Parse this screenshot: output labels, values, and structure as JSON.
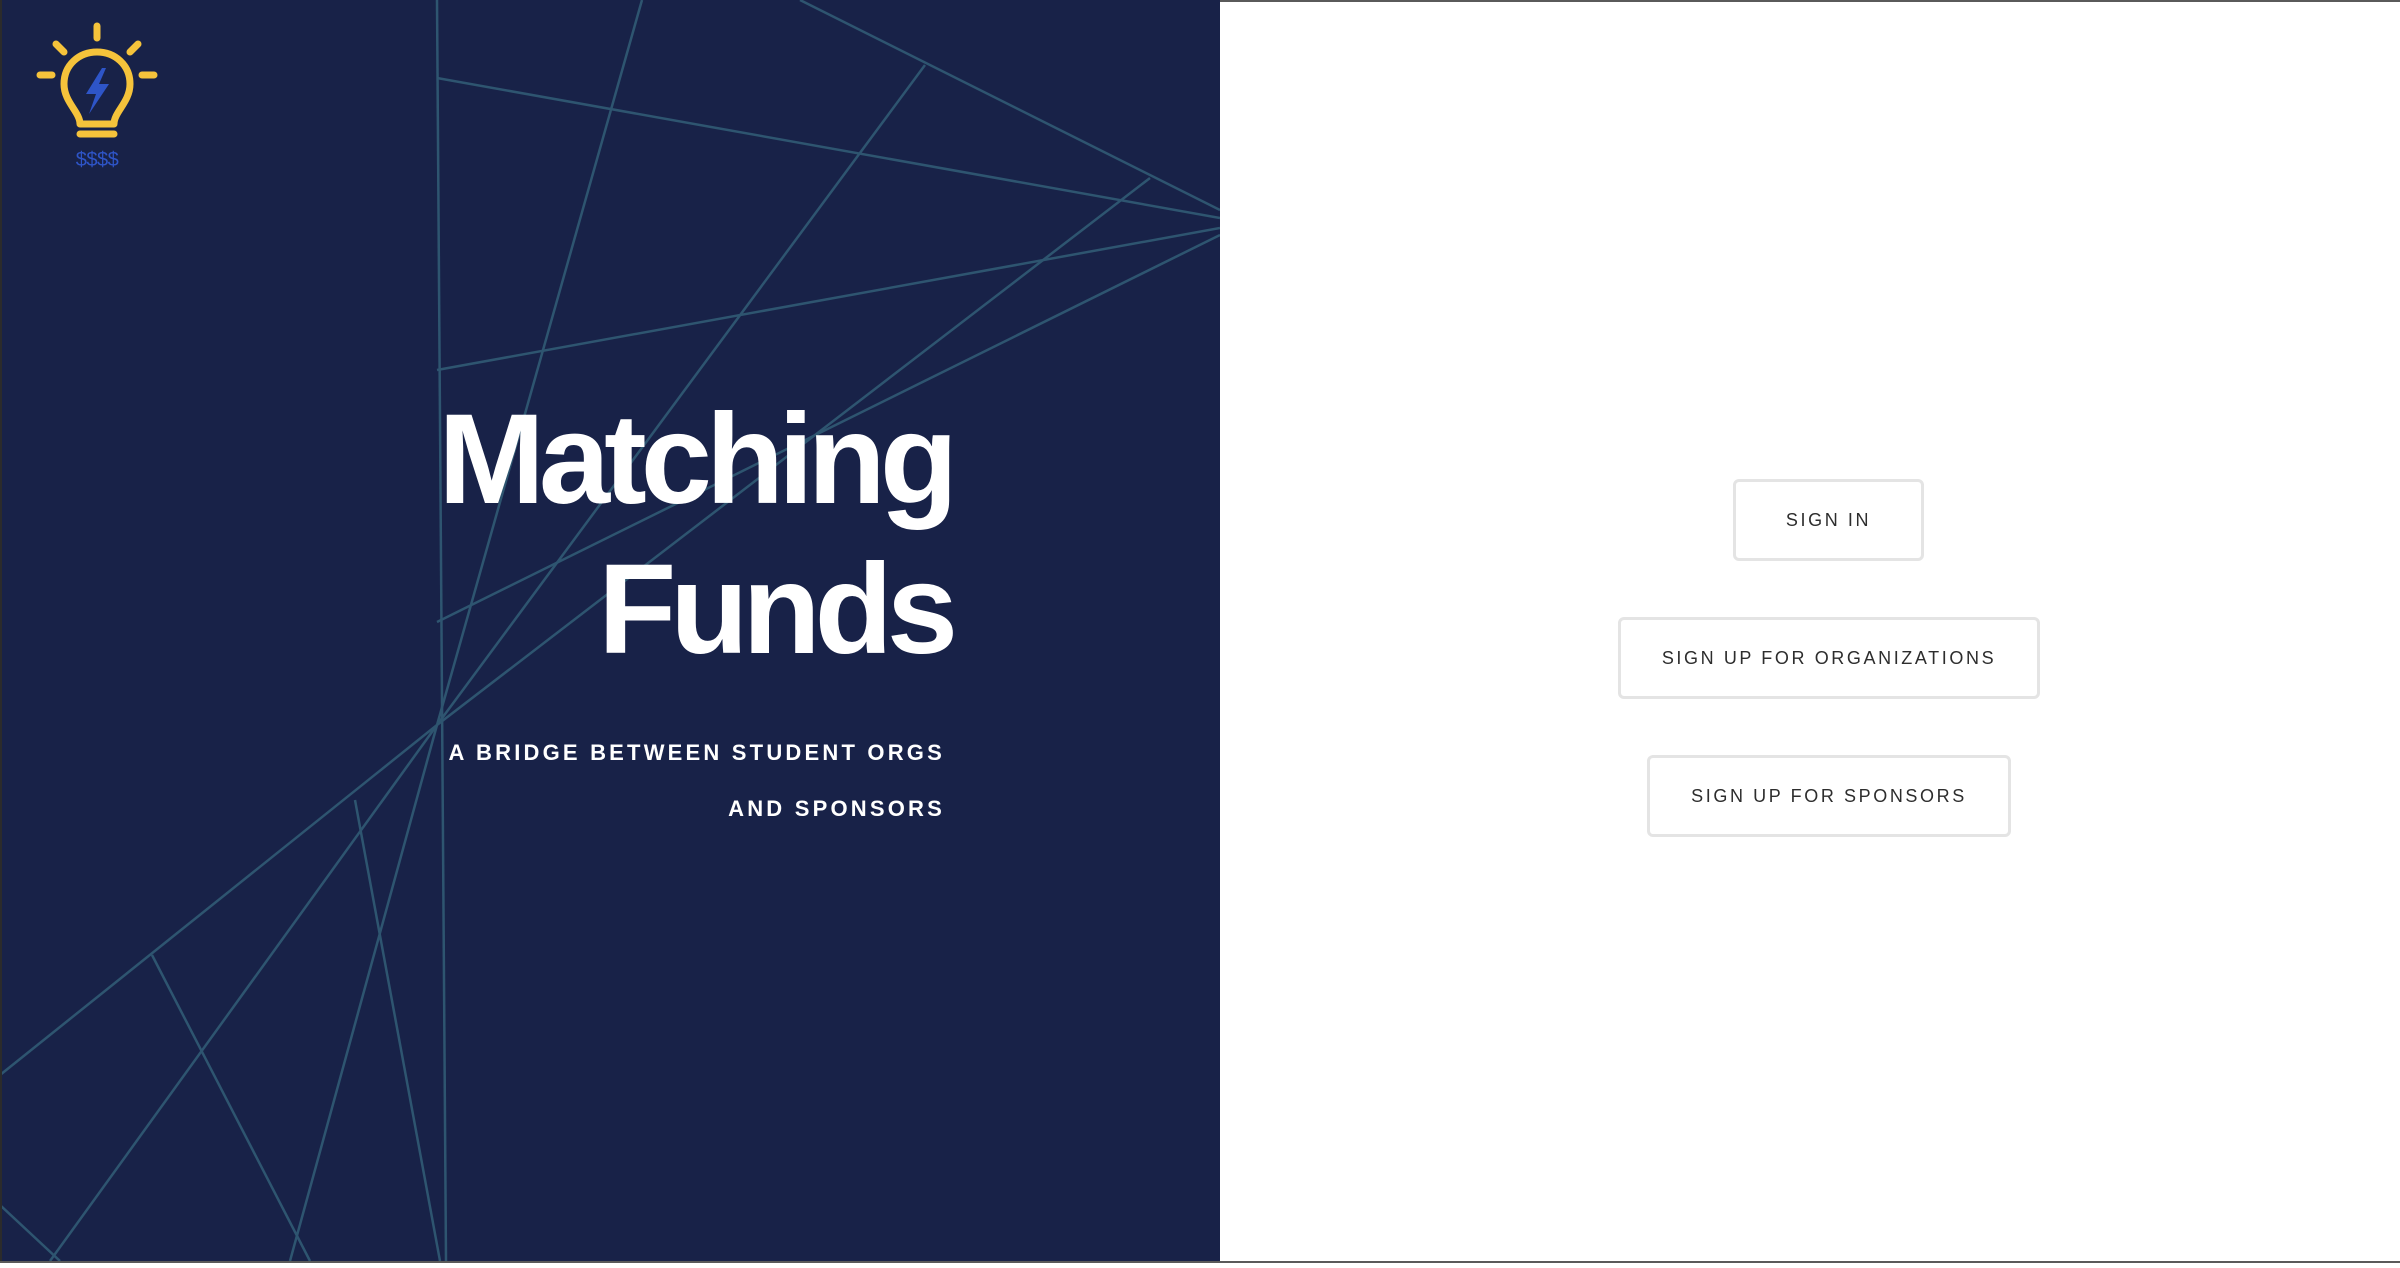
{
  "brand": {
    "logo_icon": "lightbulb-bolt-icon",
    "logo_caption": "$$$$",
    "colors": {
      "panel": "#182248",
      "lines": "#2e5570",
      "bulb": "#f5c33b",
      "bolt": "#2e55c8"
    }
  },
  "hero": {
    "title_line1": "Matching",
    "title_line2": "Funds",
    "tagline_line1": "A BRIDGE BETWEEN STUDENT ORGS",
    "tagline_line2": "AND SPONSORS"
  },
  "actions": {
    "sign_in": "SIGN IN",
    "sign_up_organizations": "SIGN UP FOR ORGANIZATIONS",
    "sign_up_sponsors": "SIGN UP FOR SPONSORS"
  }
}
